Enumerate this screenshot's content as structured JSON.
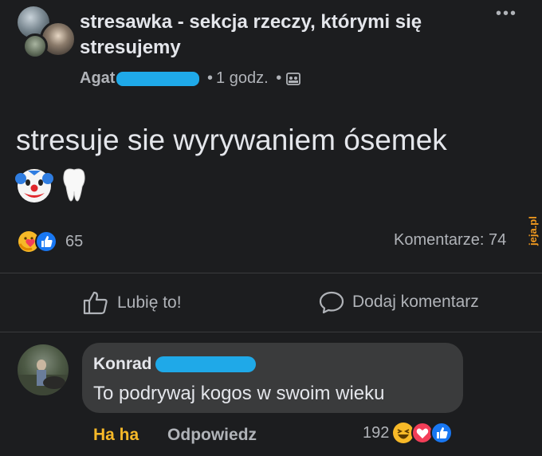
{
  "post": {
    "group_name": "stresawka - sekcja rzeczy, którymi się stresujemy",
    "author_visible": "Agat",
    "time": "1 godz.",
    "separator": "•",
    "more_label": "•••",
    "text": "stresuje sie wyrywaniem ósemek",
    "emojis": [
      "clown-face-icon",
      "tooth-icon"
    ],
    "reactions_count": "65",
    "comments_label": "Komentarze: 74",
    "watermark": "jeja.pl"
  },
  "actions": {
    "like_label": "Lubię to!",
    "comment_label": "Dodaj komentarz"
  },
  "comment": {
    "author_visible": "Konrad",
    "text": "To podrywaj kogos w swoim wieku",
    "haha_label": "Ha ha",
    "reply_label": "Odpowiedz",
    "reactions_count": "192"
  },
  "colors": {
    "background": "#1c1d1f",
    "text": "#e4e6eb",
    "muted": "#b0b3b8",
    "bubble": "#3a3b3c",
    "redaction": "#1fa9e8",
    "haha_yellow": "#f7b928",
    "like_blue": "#1877f2",
    "love_red": "#f33e58",
    "watermark_orange": "#f29a1f"
  }
}
